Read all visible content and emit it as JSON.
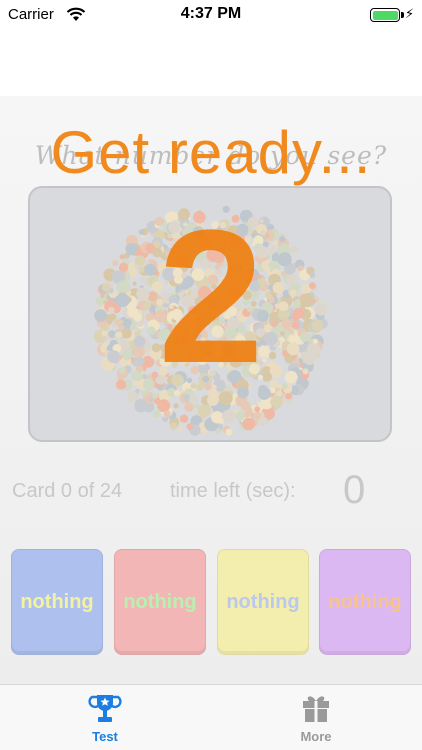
{
  "status_bar": {
    "carrier": "Carrier",
    "time": "4:37 PM"
  },
  "test": {
    "prompt": "What number do you see?",
    "overlay": "Get ready...",
    "plate_number": "2",
    "card_count": "Card 0 of 24",
    "time_left_label": "time left (sec):",
    "time_left_value": "0",
    "answers": [
      "nothing",
      "nothing",
      "nothing",
      "nothing"
    ]
  },
  "tab_bar": {
    "items": [
      {
        "label": "Test",
        "icon": "trophy-icon",
        "active": true
      },
      {
        "label": "More",
        "icon": "gift-icon",
        "active": false
      }
    ]
  },
  "colors": {
    "accent": "#1b7ee0",
    "overlay": "#f08a1f",
    "battery": "#4cd964"
  }
}
